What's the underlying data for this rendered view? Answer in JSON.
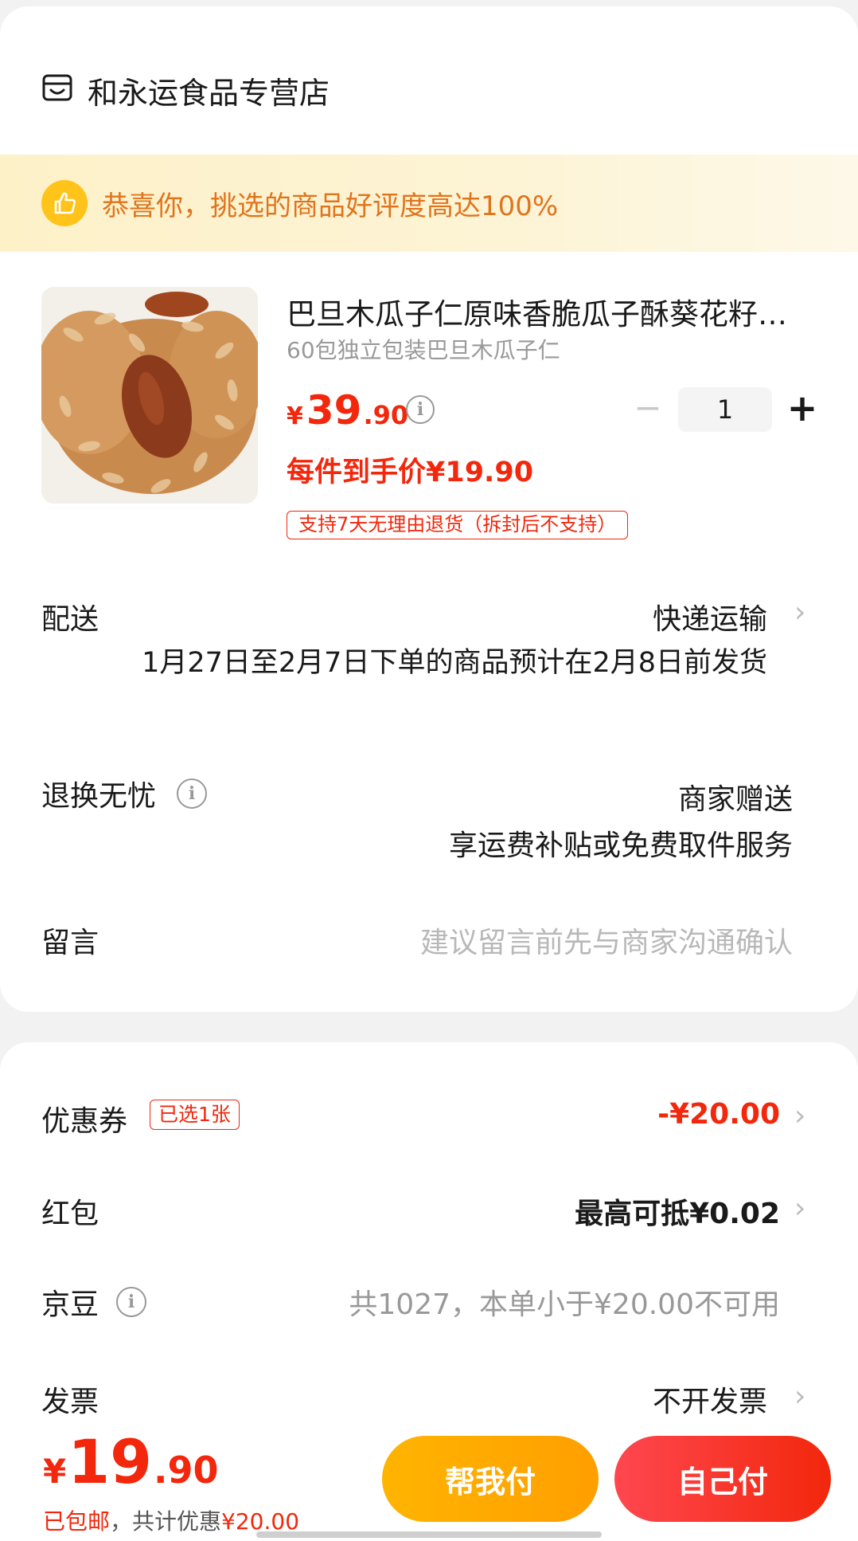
{
  "store": {
    "name": "和永运食品专营店",
    "icon": "store-icon"
  },
  "banner": {
    "text": "恭喜你，挑选的商品好评度高达100%",
    "icon": "thumbs-up-icon"
  },
  "product": {
    "title": "巴旦木瓜子仁原味香脆瓜子酥葵花籽…",
    "subtitle": "60包独立包装巴旦木瓜子仁",
    "price_symbol": "¥",
    "price_int": "39",
    "price_dec": ".90",
    "quantity": "1",
    "minus": "−",
    "plus": "+",
    "unit_price": "每件到手价¥19.90",
    "return_policy": "支持7天无理由退货（拆封后不支持）"
  },
  "shipping": {
    "label": "配送",
    "method": "快递运输",
    "detail": "1月27日至2月7日下单的商品预计在2月8日前发货"
  },
  "returns": {
    "label": "退换无忧",
    "line1": "商家赠送",
    "line2": "享运费补贴或免费取件服务"
  },
  "message": {
    "label": "留言",
    "placeholder": "建议留言前先与商家沟通确认"
  },
  "coupon": {
    "label": "优惠券",
    "tag": "已选1张",
    "value": "-¥20.00"
  },
  "red_packet": {
    "label": "红包",
    "value": "最高可抵¥0.02"
  },
  "jd_beans": {
    "label": "京豆",
    "value": "共1027，本单小于¥20.00不可用"
  },
  "invoice": {
    "label": "发票",
    "value": "不开发票"
  },
  "footer": {
    "total_symbol": "¥",
    "total_int": "19",
    "total_dec": ".90",
    "shipping_note": "已包邮",
    "discount_note": "，共计优惠",
    "discount_value": "¥20.00",
    "help_pay": "帮我付",
    "self_pay": "自己付"
  },
  "colors": {
    "accent": "#f2270c",
    "help_button": "#ffb400",
    "banner_text": "#e0741c"
  }
}
